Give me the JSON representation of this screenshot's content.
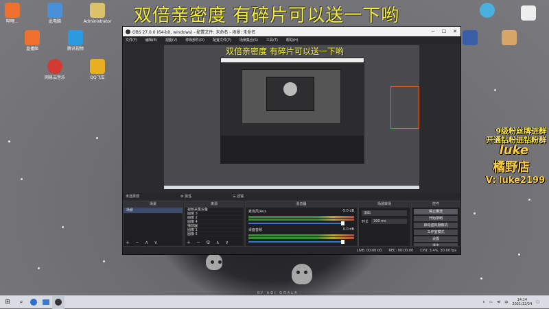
{
  "banner": "双倍亲密度 有碎片可以送一下哟",
  "desktop": {
    "icons": [
      {
        "label": "哔哩...",
        "color": "#f07030",
        "icon": "bilibili-icon"
      },
      {
        "label": "此电脑",
        "color": "#4a90d9",
        "icon": "computer-icon"
      },
      {
        "label": "Administrator",
        "color": "#d9c26a",
        "icon": "user-folder-icon"
      },
      {
        "label": "直播姬",
        "color": "#f07030",
        "icon": "live-icon"
      },
      {
        "label": "腾讯视频",
        "color": "#2d9be0",
        "icon": "video-icon"
      },
      {
        "label": "网易云音乐",
        "color": "#d33a31",
        "icon": "music-icon"
      },
      {
        "label": "QQ飞车",
        "color": "#e8b020",
        "icon": "game-icon"
      }
    ],
    "right_text": {
      "line1": "9级粉丝牌进群",
      "line2": "开通钻粉进钻粉群",
      "name": "luke",
      "shop": "橘野店",
      "contact": "V: luke2199"
    },
    "watermark": "BY ADI GOALA"
  },
  "obs": {
    "title": "OBS 27.0.0 (64-bit, windows) - 配置文件: 未命名 - 场景: 未命名",
    "menu": [
      "文件(F)",
      "编辑(E)",
      "视图(V)",
      "停靠部件(D)",
      "配置文件(P)",
      "场景集合(S)",
      "工具(T)",
      "帮助(H)"
    ],
    "no_source": "未选择源",
    "scene_panel": {
      "title": "场景",
      "items": [
        "场景"
      ]
    },
    "source_panel": {
      "title": "来源",
      "items": [
        "视频采集设备",
        "图像 3",
        "图像 2",
        "图像 4",
        "播放器",
        "图像 1",
        "图像 5"
      ]
    },
    "mixer": {
      "title": "混音器",
      "channels": [
        {
          "name": "麦克风/Aux",
          "db": "-5.0 dB"
        },
        {
          "name": "桌面音频",
          "db": "0.0 dB"
        }
      ]
    },
    "transitions": {
      "title": "场景转场",
      "type": "淡出",
      "duration_label": "时长",
      "duration": "300 ms"
    },
    "controls": {
      "title": "控件",
      "buttons": [
        "停止推流",
        "开始录制",
        "启动虚拟摄像机",
        "工作室模式",
        "设置",
        "退出"
      ]
    },
    "status": {
      "live": "LIVE: 00:00:00",
      "rec": "REC: 00:00:00",
      "cpu": "CPU: 3.4%, 30.00 fps"
    }
  },
  "taskbar": {
    "time": "14:14",
    "date": "2021/12/24"
  }
}
